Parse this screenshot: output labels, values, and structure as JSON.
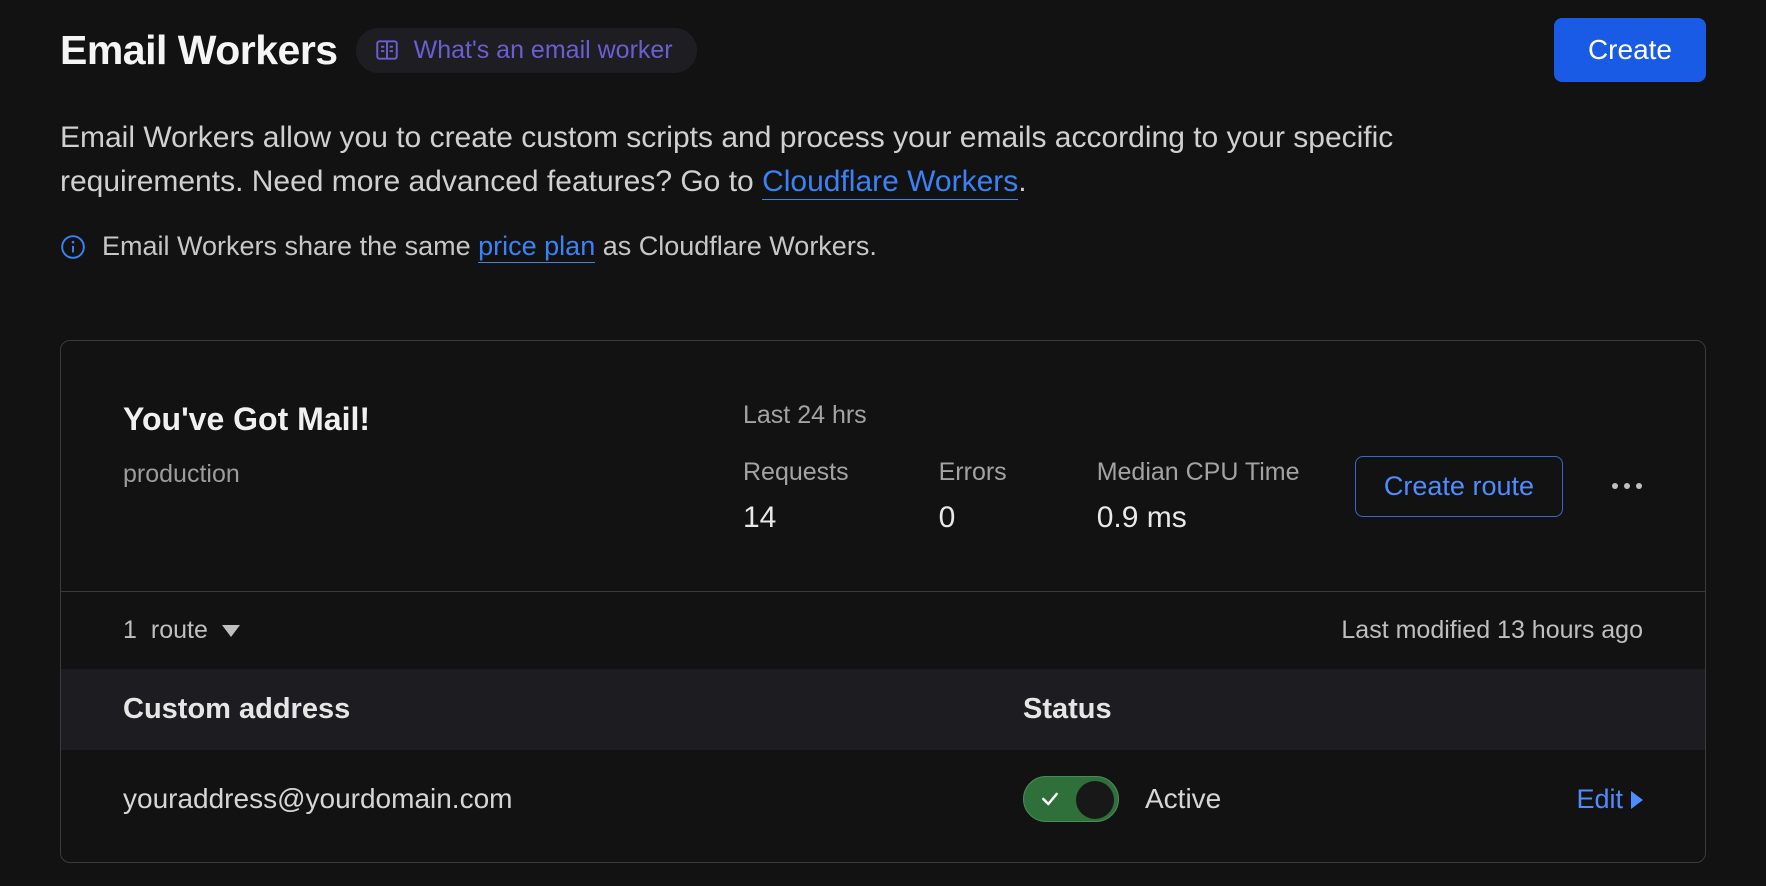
{
  "header": {
    "title": "Email Workers",
    "info_pill": "What's an email worker",
    "create_button": "Create"
  },
  "intro": {
    "text_before_link": "Email Workers allow you to create custom scripts and process your emails according to your specific requirements. Need more advanced features? Go to ",
    "link_text": "Cloudflare Workers",
    "text_after_link": "."
  },
  "price_note": {
    "before": "Email Workers share the same ",
    "link": "price plan",
    "after": " as Cloudflare Workers."
  },
  "worker": {
    "name": "You've Got Mail!",
    "env": "production",
    "timeframe_label": "Last 24 hrs",
    "stats": {
      "requests_label": "Requests",
      "requests_value": "14",
      "errors_label": "Errors",
      "errors_value": "0",
      "cpu_label": "Median CPU Time",
      "cpu_value": "0.9 ms"
    },
    "create_route_button": "Create route",
    "route_summary": {
      "count": "1",
      "label": "route",
      "last_modified": "Last modified 13 hours ago"
    },
    "table": {
      "col_address": "Custom address",
      "col_status": "Status",
      "row": {
        "address": "youraddress@yourdomain.com",
        "status_label": "Active",
        "edit_label": "Edit"
      }
    }
  }
}
